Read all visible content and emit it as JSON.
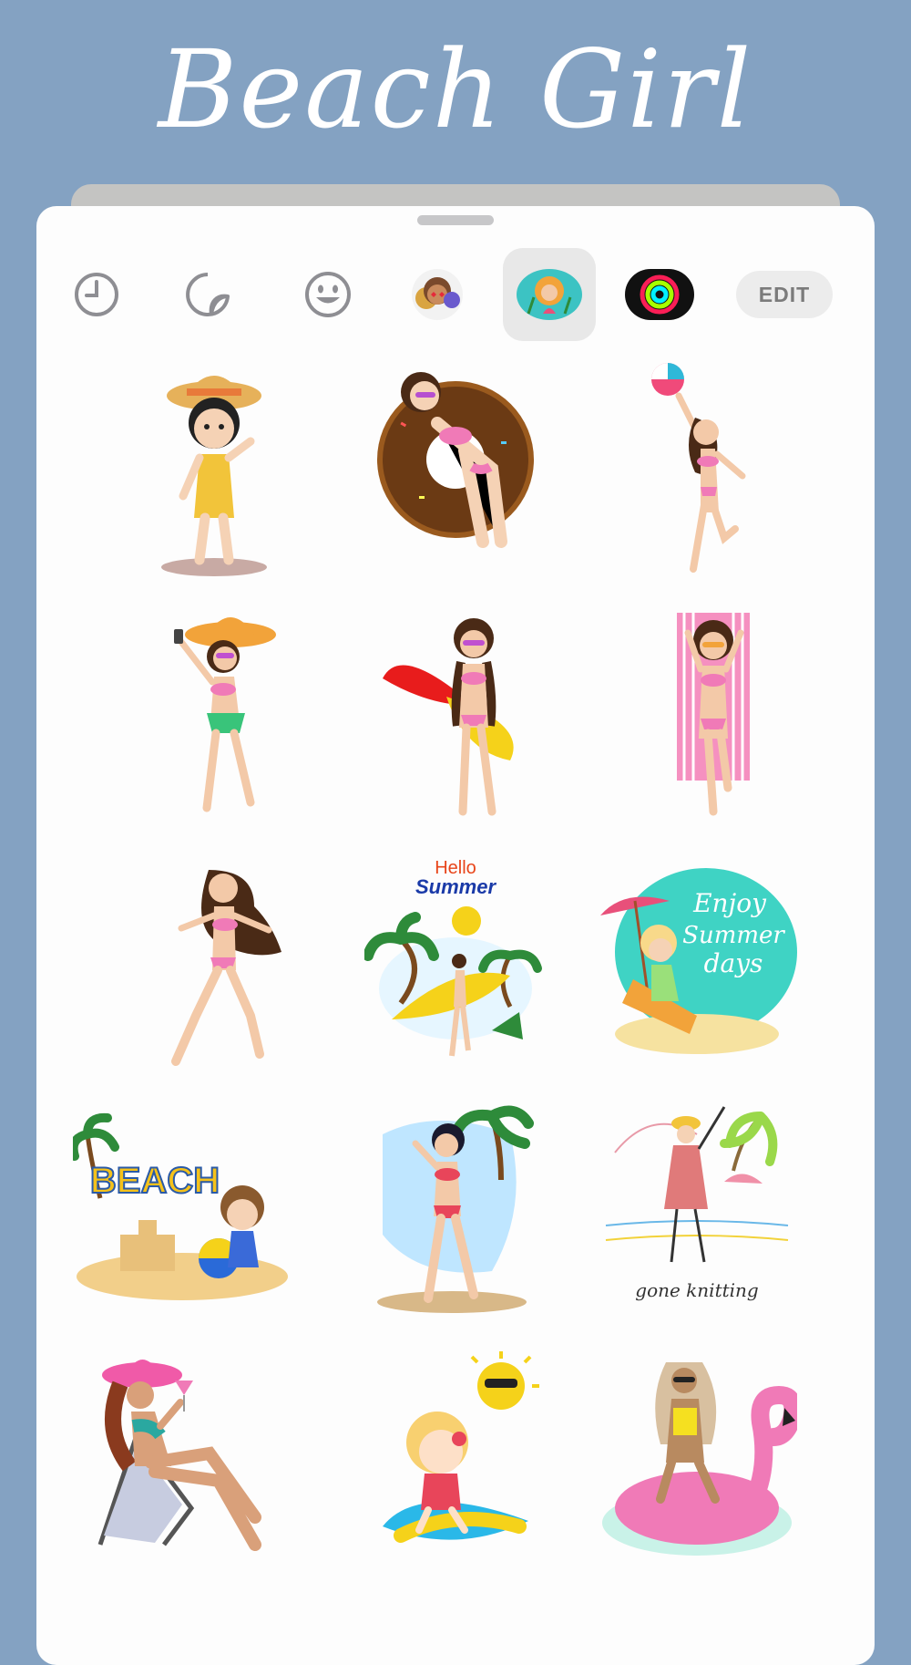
{
  "header": {
    "title": "Beach Girl"
  },
  "toolbar": {
    "items": [
      {
        "name": "recent-icon"
      },
      {
        "name": "stickers-icon"
      },
      {
        "name": "emoji-icon"
      },
      {
        "name": "memoji-pack-icon"
      },
      {
        "name": "beach-girl-pack-icon",
        "selected": true
      },
      {
        "name": "activity-rings-icon"
      }
    ],
    "edit_label": "EDIT"
  },
  "stickers": {
    "hello_line1": "Hello",
    "hello_line2": "Summer",
    "enjoy_line1": "Enjoy",
    "enjoy_line2": "Summer",
    "enjoy_line3": "days",
    "beach_text": "BEACH",
    "knitting_text": "gone knitting",
    "items": [
      "girl-straw-hat-yellow-swimsuit",
      "girl-donut-float",
      "girl-beach-ball",
      "girl-selfie-sun-hat",
      "girl-surfboard",
      "girl-beach-towel",
      "girl-dancing",
      "hello-summer-badge",
      "enjoy-summer-days-badge",
      "beach-sandcastle-kid",
      "girl-selfie-palm",
      "gone-knitting-sketch",
      "girl-deck-chair-cocktail",
      "kid-surfing-sun",
      "girl-flamingo-float"
    ]
  },
  "colors": {
    "background": "#84a2c2",
    "panel": "#fdfdfd",
    "accent_pink": "#f07ab7",
    "skin": "#f3c9a8"
  }
}
